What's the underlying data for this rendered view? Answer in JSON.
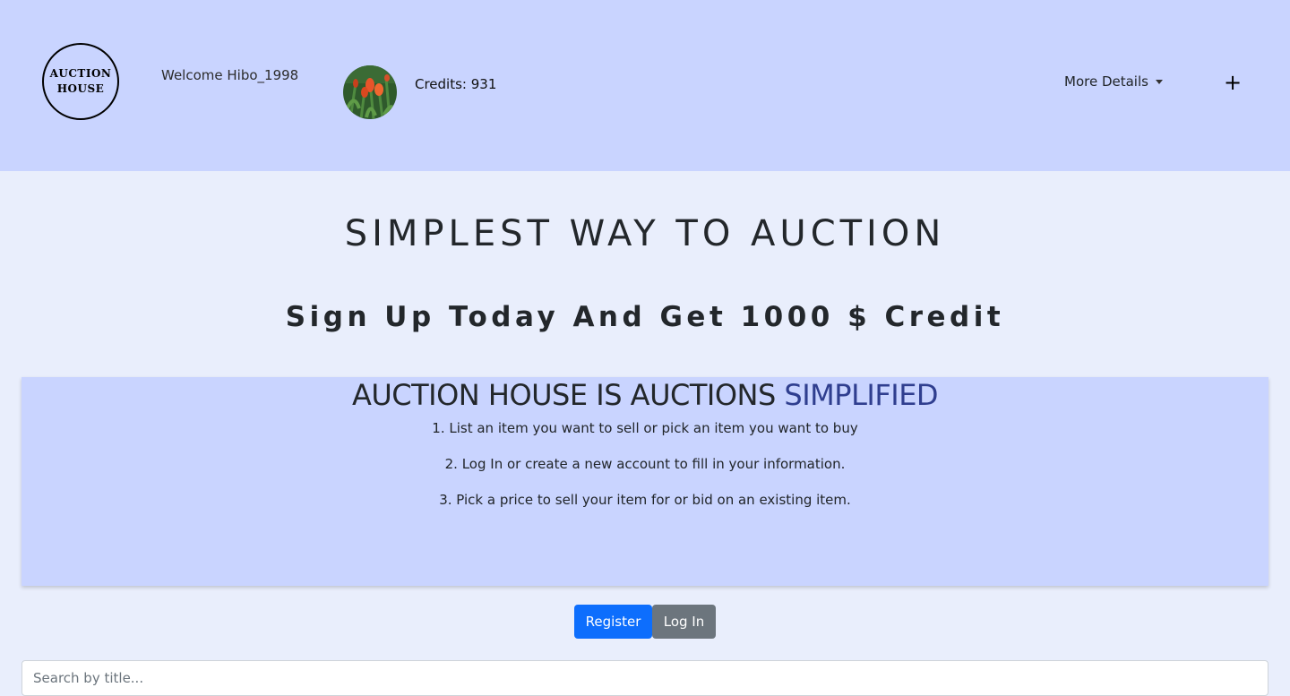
{
  "header": {
    "logo_line1": "AUCTION",
    "logo_line2": "HOUSE",
    "welcome": "Welcome Hibo_1998",
    "credits": "Credits: 931",
    "more_details": "More Details",
    "add_icon": "plus-icon"
  },
  "hero": {
    "title": "SIMPLEST WAY TO AUCTION",
    "subtitle": "Sign Up Today And Get 1000 $ Credit"
  },
  "info": {
    "heading_main": "AUCTION HOUSE IS AUCTIONS ",
    "heading_accent": "SIMPLIFIED",
    "steps": [
      "1. List an item you want to sell or pick an item you want to buy",
      "2. Log In or create a new account to fill in your information.",
      "3. Pick a price to sell your item for or bid on an existing item."
    ]
  },
  "actions": {
    "register": "Register",
    "login": "Log In"
  },
  "search": {
    "placeholder": "Search by title..."
  },
  "colors": {
    "header_bg": "#c9d4ff",
    "page_bg": "#e9eefc",
    "accent": "#2f3e8f",
    "primary": "#0d6efd",
    "secondary": "#6c757d"
  }
}
